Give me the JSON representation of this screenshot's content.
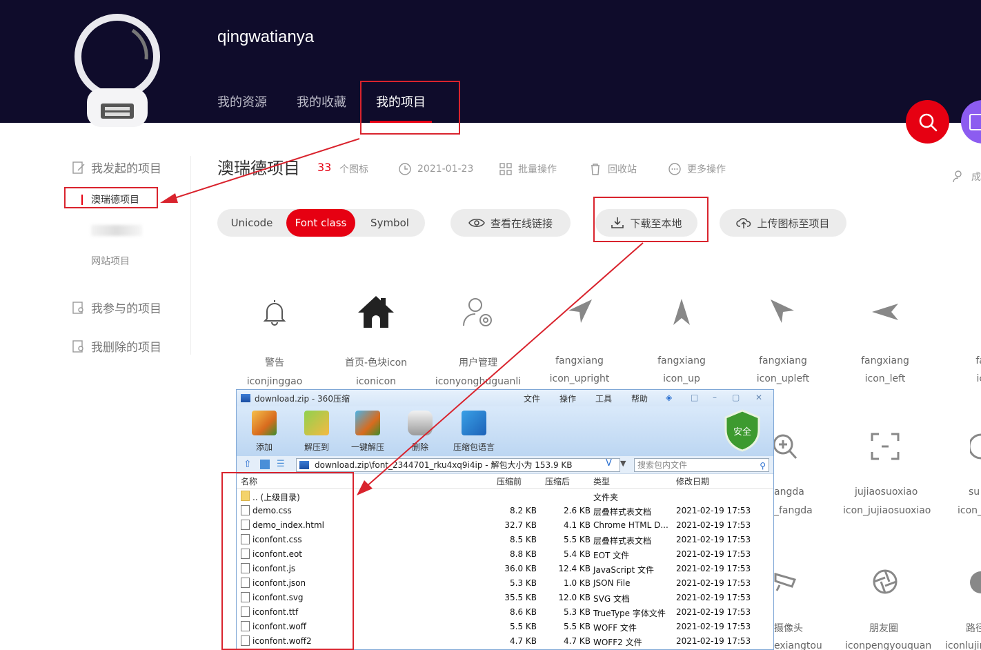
{
  "header": {
    "username": "qingwatianya",
    "tabs": [
      "我的资源",
      "我的收藏",
      "我的项目"
    ],
    "active_tab": "我的项目"
  },
  "sidebar": {
    "started_label": "我发起的项目",
    "active_project": "澳瑞德项目",
    "website_projects": "网站项目",
    "joined_label": "我参与的项目",
    "deleted_label": "我删除的项目"
  },
  "project": {
    "title": "澳瑞德项目",
    "icon_count": "33",
    "icon_count_unit": "个图标",
    "date": "2021-01-23",
    "batch_ops": "批量操作",
    "recycle_bin": "回收站",
    "more_ops": "更多操作",
    "members_partial": "成"
  },
  "toolbar": {
    "modes": [
      "Unicode",
      "Font class",
      "Symbol"
    ],
    "active_mode": "Font class",
    "view_link": "查看在线链接",
    "download": "下载至本地",
    "upload": "上传图标至项目"
  },
  "icons": [
    {
      "name": "警告",
      "code": "iconjinggao"
    },
    {
      "name": "首页-色块icon",
      "code": "iconicon"
    },
    {
      "name": "用户管理",
      "code": "iconyonghuguanli"
    },
    {
      "name": "fangxiang",
      "code": "icon_upright"
    },
    {
      "name": "fangxiang",
      "code": "icon_up"
    },
    {
      "name": "fangxiang",
      "code": "icon_upleft"
    },
    {
      "name": "fangxiang",
      "code": "icon_left"
    },
    {
      "name": "fang",
      "code": "icon"
    }
  ],
  "icons_row2": [
    {
      "name": "angda",
      "code": "_fangda"
    },
    {
      "name": "jujiaosuoxiao",
      "code": "icon_jujiaosuoxiao"
    },
    {
      "name": "su",
      "code": "icon_"
    }
  ],
  "icons_row3": [
    {
      "name": "摄像头",
      "code": "exiangtou"
    },
    {
      "name": "朋友圈",
      "code": "iconpengyouquan"
    },
    {
      "name": "路径",
      "code": "iconlujin"
    }
  ],
  "zip": {
    "title": "download.zip - 360压缩",
    "menu": [
      "文件",
      "操作",
      "工具",
      "帮助"
    ],
    "tools": [
      "添加",
      "解压到",
      "一键解压",
      "删除",
      "压缩包语言"
    ],
    "safe_label": "安全",
    "path": "download.zip\\font_2344701_rku4xq9i4ip - 解包大小为 153.9 KB",
    "search_placeholder": "搜索包内文件",
    "columns": [
      "名称",
      "压缩前",
      "压缩后",
      "类型",
      "修改日期"
    ],
    "rows": [
      {
        "name": ".. (上级目录)",
        "before": "",
        "after": "",
        "type": "文件夹",
        "date": ""
      },
      {
        "name": "demo.css",
        "before": "8.2 KB",
        "after": "2.6 KB",
        "type": "层叠样式表文档",
        "date": "2021-02-19 17:53"
      },
      {
        "name": "demo_index.html",
        "before": "32.7 KB",
        "after": "4.1 KB",
        "type": "Chrome HTML D...",
        "date": "2021-02-19 17:53"
      },
      {
        "name": "iconfont.css",
        "before": "8.5 KB",
        "after": "5.5 KB",
        "type": "层叠样式表文档",
        "date": "2021-02-19 17:53"
      },
      {
        "name": "iconfont.eot",
        "before": "8.8 KB",
        "after": "5.4 KB",
        "type": "EOT 文件",
        "date": "2021-02-19 17:53"
      },
      {
        "name": "iconfont.js",
        "before": "36.0 KB",
        "after": "12.4 KB",
        "type": "JavaScript 文件",
        "date": "2021-02-19 17:53"
      },
      {
        "name": "iconfont.json",
        "before": "5.3 KB",
        "after": "1.0 KB",
        "type": "JSON File",
        "date": "2021-02-19 17:53"
      },
      {
        "name": "iconfont.svg",
        "before": "35.5 KB",
        "after": "12.0 KB",
        "type": "SVG 文档",
        "date": "2021-02-19 17:53"
      },
      {
        "name": "iconfont.ttf",
        "before": "8.6 KB",
        "after": "5.3 KB",
        "type": "TrueType 字体文件",
        "date": "2021-02-19 17:53"
      },
      {
        "name": "iconfont.woff",
        "before": "5.5 KB",
        "after": "5.5 KB",
        "type": "WOFF 文件",
        "date": "2021-02-19 17:53"
      },
      {
        "name": "iconfont.woff2",
        "before": "4.7 KB",
        "after": "4.7 KB",
        "type": "WOFF2 文件",
        "date": "2021-02-19 17:53"
      }
    ]
  },
  "colors": {
    "brand_red": "#e60012",
    "header_bg": "#0f0c2b",
    "annotation_red": "#d9232d"
  }
}
